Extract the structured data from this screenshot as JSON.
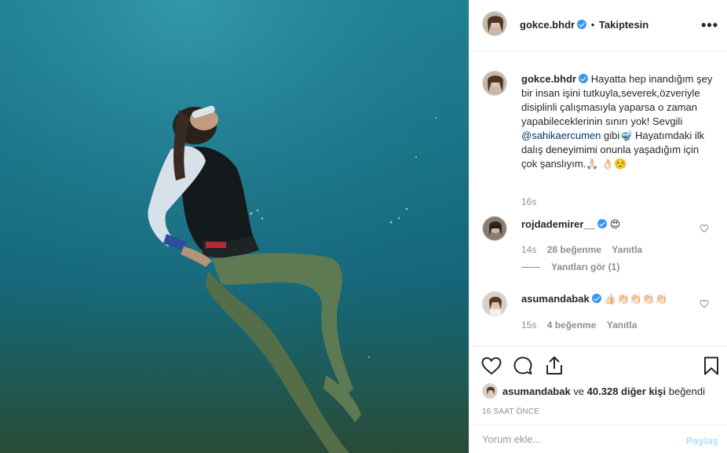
{
  "colors": {
    "accent": "#3897f0",
    "text": "#262626",
    "muted": "#8e8e8e",
    "post_disabled": "#b2dffc",
    "mention": "#003569"
  },
  "header": {
    "username": "gokce.bhdr",
    "dot": "•",
    "follow_state": "Takiptesin",
    "more_icon": "more-horizontal-icon"
  },
  "caption": {
    "username": "gokce.bhdr",
    "text_before_mention": "Hayatta hep inandığım şey bir insan işini tutkuyla,severek,özveriyle disiplinli çalışmasıyla yaparsa o zaman yapabileceklerinin sınırı yok! Sevgili ",
    "mention": "@sahikaercumen",
    "text_after_mention": " gibi🤿 Hayatımdaki ilk dalış deneyimimi onunla yaşadığım için çok şanslıyım.🙏🏻 👌🏻☺️",
    "age": "16s"
  },
  "comments": [
    {
      "username": "rojdademirer__",
      "text": "😍",
      "age": "14s",
      "likes": "28 beğenme",
      "reply_label": "Yanıtla",
      "view_replies": "Yanıtları gör (1)"
    },
    {
      "username": "asumandabak",
      "text": "👍🏻👏🏻👏🏻👏🏻👏🏻",
      "age": "15s",
      "likes": "4 beğenme",
      "reply_label": "Yanıtla"
    }
  ],
  "actions": {
    "like_icon": "heart-icon",
    "comment_icon": "comment-icon",
    "share_icon": "share-icon",
    "save_icon": "bookmark-icon"
  },
  "likes": {
    "first_user": "asumandabak",
    "connector": " ve ",
    "count_text": "40.328 diğer kişi",
    "suffix": " beğendi"
  },
  "timestamp": "16 SAAT ÖNCE",
  "add_comment": {
    "placeholder": "Yorum ekle...",
    "post_label": "Paylaş"
  }
}
